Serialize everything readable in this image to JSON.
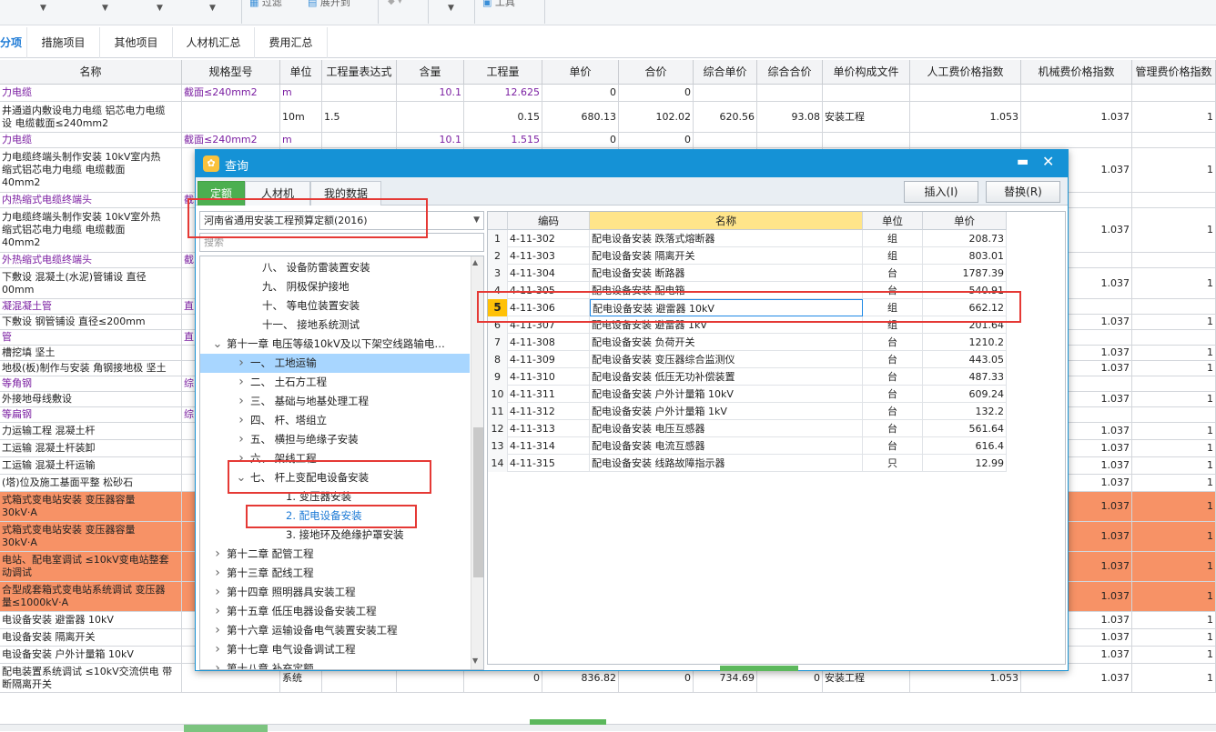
{
  "toolbar": {
    "items": [
      "过滤",
      "展开到",
      "工具"
    ]
  },
  "tabs": [
    "分项",
    "措施项目",
    "其他项目",
    "人材机汇总",
    "费用汇总"
  ],
  "main_table": {
    "columns": [
      "名称",
      "规格型号",
      "单位",
      "工程量表达式",
      "含量",
      "工程量",
      "单价",
      "合价",
      "综合单价",
      "综合合价",
      "单价构成文件",
      "人工费价格指数",
      "机械费价格指数",
      "管理费价格指数"
    ],
    "rows": [
      {
        "name": "力电缆",
        "spec": "截面≤240mm2",
        "unit": "m",
        "expr": "",
        "qty_ratio": "10.1",
        "qty": "12.625",
        "price": "0",
        "total": "0",
        "comp_price": "",
        "comp_total": "",
        "file": "",
        "labor": "",
        "mech": "",
        "mgmt": "",
        "purple": true
      },
      {
        "name": "井通道内敷设电力电缆 铝芯电力电缆\n设 电缆截面≤240mm2",
        "spec": "",
        "unit": "10m",
        "expr": "1.5",
        "qty_ratio": "",
        "qty": "0.15",
        "price": "680.13",
        "total": "102.02",
        "comp_price": "620.56",
        "comp_total": "93.08",
        "file": "安装工程",
        "labor": "1.053",
        "mech": "1.037",
        "mgmt": "1"
      },
      {
        "name": "力电缆",
        "spec": "截面≤240mm2",
        "unit": "m",
        "expr": "",
        "qty_ratio": "10.1",
        "qty": "1.515",
        "price": "0",
        "total": "0",
        "comp_price": "",
        "comp_total": "",
        "file": "",
        "labor": "",
        "mech": "",
        "mgmt": "",
        "purple": true
      },
      {
        "name": "力电缆终端头制作安装 10kV室内热\n缩式铝芯电力电缆 电缆截面\n40mm2",
        "spec": "",
        "unit": "",
        "expr": "",
        "qty_ratio": "",
        "qty": "",
        "price": "",
        "total": "",
        "comp_price": "",
        "comp_total": "",
        "file": "",
        "labor": "",
        "mech": "1.037",
        "mgmt": "1"
      },
      {
        "name": "内热缩式电缆终端头",
        "spec": "截",
        "unit": "",
        "expr": "",
        "qty_ratio": "",
        "qty": "",
        "price": "",
        "total": "",
        "comp_price": "",
        "comp_total": "",
        "file": "",
        "labor": "",
        "mech": "",
        "mgmt": "",
        "purple": true
      },
      {
        "name": "力电缆终端头制作安装 10kV室外热\n缩式铝芯电力电缆 电缆截面\n40mm2",
        "spec": "",
        "unit": "",
        "expr": "",
        "qty_ratio": "",
        "qty": "",
        "price": "",
        "total": "",
        "comp_price": "",
        "comp_total": "",
        "file": "",
        "labor": "",
        "mech": "1.037",
        "mgmt": "1"
      },
      {
        "name": "外热缩式电缆终端头",
        "spec": "截",
        "unit": "",
        "expr": "",
        "qty_ratio": "",
        "qty": "",
        "price": "",
        "total": "",
        "comp_price": "",
        "comp_total": "",
        "file": "",
        "labor": "",
        "mech": "",
        "mgmt": "",
        "purple": true
      },
      {
        "name": "下敷设 混凝土(水泥)管铺设 直径\n00mm",
        "spec": "",
        "unit": "",
        "expr": "",
        "qty_ratio": "",
        "qty": "",
        "price": "",
        "total": "",
        "comp_price": "",
        "comp_total": "",
        "file": "",
        "labor": "",
        "mech": "1.037",
        "mgmt": "1"
      },
      {
        "name": "凝混凝土管",
        "spec": "直",
        "unit": "",
        "expr": "",
        "qty_ratio": "",
        "qty": "",
        "price": "",
        "total": "",
        "comp_price": "",
        "comp_total": "",
        "file": "",
        "labor": "",
        "mech": "",
        "mgmt": "",
        "purple": true
      },
      {
        "name": "下敷设 钢管铺设 直径≤200mm",
        "spec": "",
        "unit": "",
        "expr": "",
        "qty_ratio": "",
        "qty": "",
        "price": "",
        "total": "",
        "comp_price": "",
        "comp_total": "",
        "file": "",
        "labor": "",
        "mech": "1.037",
        "mgmt": "1"
      },
      {
        "name": "管",
        "spec": "直",
        "unit": "",
        "expr": "",
        "qty_ratio": "",
        "qty": "",
        "price": "",
        "total": "",
        "comp_price": "",
        "comp_total": "",
        "file": "",
        "labor": "",
        "mech": "",
        "mgmt": "",
        "purple": true
      },
      {
        "name": "槽挖填 坚土",
        "spec": "",
        "unit": "",
        "expr": "",
        "qty_ratio": "",
        "qty": "",
        "price": "",
        "total": "",
        "comp_price": "",
        "comp_total": "",
        "file": "",
        "labor": "",
        "mech": "1.037",
        "mgmt": "1"
      },
      {
        "name": "地极(板)制作与安装 角钢接地极 坚土",
        "spec": "",
        "unit": "",
        "expr": "",
        "qty_ratio": "",
        "qty": "",
        "price": "",
        "total": "",
        "comp_price": "",
        "comp_total": "",
        "file": "",
        "labor": "",
        "mech": "1.037",
        "mgmt": "1"
      },
      {
        "name": "等角钢",
        "spec": "综",
        "unit": "",
        "expr": "",
        "qty_ratio": "",
        "qty": "",
        "price": "",
        "total": "",
        "comp_price": "",
        "comp_total": "",
        "file": "",
        "labor": "",
        "mech": "",
        "mgmt": "",
        "purple": true
      },
      {
        "name": "外接地母线敷设",
        "spec": "",
        "unit": "",
        "expr": "",
        "qty_ratio": "",
        "qty": "",
        "price": "",
        "total": "",
        "comp_price": "",
        "comp_total": "",
        "file": "",
        "labor": "",
        "mech": "1.037",
        "mgmt": "1"
      },
      {
        "name": "等扁钢",
        "spec": "综",
        "unit": "",
        "expr": "",
        "qty_ratio": "",
        "qty": "",
        "price": "",
        "total": "",
        "comp_price": "",
        "comp_total": "",
        "file": "",
        "labor": "",
        "mech": "",
        "mgmt": "",
        "purple": true
      },
      {
        "name": "力运输工程 混凝土杆",
        "spec": "",
        "unit": "",
        "expr": "",
        "qty_ratio": "",
        "qty": "",
        "price": "",
        "total": "",
        "comp_price": "",
        "comp_total": "",
        "file": "",
        "labor": "",
        "mech": "1.037",
        "mgmt": "1"
      },
      {
        "name": "工运输 混凝土杆装卸",
        "spec": "",
        "unit": "",
        "expr": "",
        "qty_ratio": "",
        "qty": "",
        "price": "",
        "total": "",
        "comp_price": "",
        "comp_total": "",
        "file": "",
        "labor": "",
        "mech": "1.037",
        "mgmt": "1"
      },
      {
        "name": "工运输 混凝土杆运输",
        "spec": "",
        "unit": "",
        "expr": "",
        "qty_ratio": "",
        "qty": "",
        "price": "",
        "total": "",
        "comp_price": "",
        "comp_total": "",
        "file": "",
        "labor": "",
        "mech": "1.037",
        "mgmt": "1"
      },
      {
        "name": "(塔)位及施工基面平整 松砂石",
        "spec": "",
        "unit": "",
        "expr": "",
        "qty_ratio": "",
        "qty": "",
        "price": "",
        "total": "",
        "comp_price": "",
        "comp_total": "",
        "file": "",
        "labor": "",
        "mech": "1.037",
        "mgmt": "1"
      },
      {
        "name": "式箱式变电站安装 变压器容量\n30kV·A",
        "spec": "",
        "unit": "",
        "expr": "",
        "qty_ratio": "",
        "qty": "",
        "price": "",
        "total": "",
        "comp_price": "",
        "comp_total": "",
        "file": "",
        "labor": "",
        "mech": "1.037",
        "mgmt": "1",
        "orange": true
      },
      {
        "name": "式箱式变电站安装 变压器容量\n30kV·A",
        "spec": "",
        "unit": "",
        "expr": "",
        "qty_ratio": "",
        "qty": "",
        "price": "",
        "total": "",
        "comp_price": "",
        "comp_total": "",
        "file": "",
        "labor": "",
        "mech": "1.037",
        "mgmt": "1",
        "orange": true
      },
      {
        "name": "电站、配电室调试 ≤10kV变电站整套\n动调试",
        "spec": "",
        "unit": "",
        "expr": "",
        "qty_ratio": "",
        "qty": "",
        "price": "",
        "total": "",
        "comp_price": "",
        "comp_total": "",
        "file": "",
        "labor": "",
        "mech": "1.037",
        "mgmt": "1",
        "orange": true
      },
      {
        "name": "合型成套箱式变电站系统调试 变压器\n量≤1000kV·A",
        "spec": "",
        "unit": "",
        "expr": "",
        "qty_ratio": "",
        "qty": "",
        "price": "",
        "total": "",
        "comp_price": "",
        "comp_total": "",
        "file": "",
        "labor": "",
        "mech": "1.037",
        "mgmt": "1",
        "orange": true
      },
      {
        "name": "电设备安装 避雷器 10kV",
        "spec": "",
        "unit": "",
        "expr": "",
        "qty_ratio": "",
        "qty": "",
        "price": "",
        "total": "",
        "comp_price": "",
        "comp_total": "",
        "file": "",
        "labor": "",
        "mech": "1.037",
        "mgmt": "1"
      },
      {
        "name": "电设备安装 隔离开关",
        "spec": "",
        "unit": "",
        "expr": "",
        "qty_ratio": "",
        "qty": "",
        "price": "",
        "total": "",
        "comp_price": "",
        "comp_total": "",
        "file": "",
        "labor": "",
        "mech": "1.037",
        "mgmt": "1"
      },
      {
        "name": "电设备安装 户外计量箱 10kV",
        "spec": "",
        "unit": "",
        "expr": "",
        "qty_ratio": "",
        "qty": "",
        "price": "",
        "total": "",
        "comp_price": "",
        "comp_total": "",
        "file": "",
        "labor": "",
        "mech": "1.037",
        "mgmt": "1"
      },
      {
        "name": "配电装置系统调试 ≤10kV交流供电 带\n断隔离开关",
        "spec": "",
        "unit": "系统",
        "expr": "",
        "qty_ratio": "",
        "qty": "0",
        "price": "836.82",
        "total": "0",
        "comp_price": "734.69",
        "comp_total": "0",
        "file": "安装工程",
        "labor": "1.053",
        "mech": "1.037",
        "mgmt": "1"
      }
    ]
  },
  "dialog": {
    "title": "查询",
    "tabs": [
      "定额",
      "人材机",
      "我的数据"
    ],
    "insert_label": "插入(I)",
    "replace_label": "替换(R)",
    "quota_select": "河南省通用安装工程预算定额(2016)",
    "search_placeholder": "搜索",
    "tree": [
      {
        "label": "八、 设备防雷装置安装",
        "indent": 4,
        "chev": ""
      },
      {
        "label": "九、 阴极保护接地",
        "indent": 4,
        "chev": ""
      },
      {
        "label": "十、 等电位装置安装",
        "indent": 4,
        "chev": ""
      },
      {
        "label": "十一、 接地系统测试",
        "indent": 4,
        "chev": ""
      },
      {
        "label": "第十一章 电压等级10kV及以下架空线路输电…",
        "indent": 1,
        "chev": "v"
      },
      {
        "label": "一、 工地运输",
        "indent": 3,
        "chev": ">",
        "hl": true
      },
      {
        "label": "二、 土石方工程",
        "indent": 3,
        "chev": ">"
      },
      {
        "label": "三、 基础与地基处理工程",
        "indent": 3,
        "chev": ">"
      },
      {
        "label": "四、 杆、塔组立",
        "indent": 3,
        "chev": ">"
      },
      {
        "label": "五、 横担与绝缘子安装",
        "indent": 3,
        "chev": ">"
      },
      {
        "label": "六、 架线工程",
        "indent": 3,
        "chev": ">"
      },
      {
        "label": "七、 杆上变配电设备安装",
        "indent": 3,
        "chev": "v"
      },
      {
        "label": "1. 变压器安装",
        "indent": 6,
        "chev": ""
      },
      {
        "label": "2. 配电设备安装",
        "indent": 6,
        "chev": "",
        "blue": true
      },
      {
        "label": "3. 接地环及绝缘护罩安装",
        "indent": 6,
        "chev": ""
      },
      {
        "label": "第十二章 配管工程",
        "indent": 1,
        "chev": ">"
      },
      {
        "label": "第十三章 配线工程",
        "indent": 1,
        "chev": ">"
      },
      {
        "label": "第十四章 照明器具安装工程",
        "indent": 1,
        "chev": ">"
      },
      {
        "label": "第十五章 低压电器设备安装工程",
        "indent": 1,
        "chev": ">"
      },
      {
        "label": "第十六章 运输设备电气装置安装工程",
        "indent": 1,
        "chev": ">"
      },
      {
        "label": "第十七章 电气设备调试工程",
        "indent": 1,
        "chev": ">"
      },
      {
        "label": "第十八章 补充定额",
        "indent": 1,
        "chev": ">"
      }
    ],
    "grid_headers": [
      "",
      "编码",
      "名称",
      "单位",
      "单价"
    ],
    "grid_rows": [
      {
        "no": "1",
        "code": "4-11-302",
        "name": "配电设备安装 跌落式熔断器",
        "unit": "组",
        "price": "208.73"
      },
      {
        "no": "2",
        "code": "4-11-303",
        "name": "配电设备安装 隔离开关",
        "unit": "组",
        "price": "803.01"
      },
      {
        "no": "3",
        "code": "4-11-304",
        "name": "配电设备安装 断路器",
        "unit": "台",
        "price": "1787.39"
      },
      {
        "no": "4",
        "code": "4-11-305",
        "name": "配电设备安装 配电箱",
        "unit": "台",
        "price": "540.91"
      },
      {
        "no": "5",
        "code": "4-11-306",
        "name": "配电设备安装 避雷器 10kV",
        "unit": "组",
        "price": "662.12",
        "selected": true
      },
      {
        "no": "6",
        "code": "4-11-307",
        "name": "配电设备安装 避雷器 1kV",
        "unit": "组",
        "price": "201.64"
      },
      {
        "no": "7",
        "code": "4-11-308",
        "name": "配电设备安装 负荷开关",
        "unit": "台",
        "price": "1210.2"
      },
      {
        "no": "8",
        "code": "4-11-309",
        "name": "配电设备安装 变压器综合监测仪",
        "unit": "台",
        "price": "443.05"
      },
      {
        "no": "9",
        "code": "4-11-310",
        "name": "配电设备安装 低压无功补偿装置",
        "unit": "台",
        "price": "487.33"
      },
      {
        "no": "10",
        "code": "4-11-311",
        "name": "配电设备安装 户外计量箱 10kV",
        "unit": "台",
        "price": "609.24"
      },
      {
        "no": "11",
        "code": "4-11-312",
        "name": "配电设备安装 户外计量箱 1kV",
        "unit": "台",
        "price": "132.2"
      },
      {
        "no": "12",
        "code": "4-11-313",
        "name": "配电设备安装 电压互感器",
        "unit": "台",
        "price": "561.64"
      },
      {
        "no": "13",
        "code": "4-11-314",
        "name": "配电设备安装 电流互感器",
        "unit": "台",
        "price": "616.4"
      },
      {
        "no": "14",
        "code": "4-11-315",
        "name": "配电设备安装 线路故障指示器",
        "unit": "只",
        "price": "12.99"
      }
    ]
  },
  "colors": {
    "accent": "#1592d6",
    "orange_row": "#f79266",
    "purple_text": "#7b1fa2",
    "annotation_red": "#e53935",
    "tab_green": "#4caf50"
  }
}
